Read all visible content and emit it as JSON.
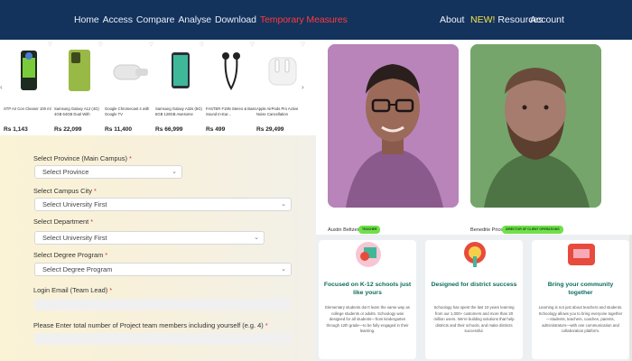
{
  "topnav": {
    "left_items": [
      "Home",
      "Access",
      "Compare",
      "Analyse",
      "Download"
    ],
    "highlight_item": "Temporary Measures",
    "about": "About",
    "new_badge": "NEW!",
    "resources": "Resources",
    "account": "Account",
    "colors": {
      "bar": "#13325c",
      "highlight": "#ff3b3b",
      "new": "#f6e34c"
    }
  },
  "products": [
    {
      "name": "STP Air Con Cleaner 100 ml",
      "price": "Rs 1,143",
      "icon": "spray-can-icon"
    },
    {
      "name": "Samsung Galaxy A12 (4G) 4GB 64GB Dual With",
      "price": "Rs 22,099",
      "icon": "phone-icon"
    },
    {
      "name": "Google Chromecast 4 with Google TV",
      "price": "Rs 11,400",
      "icon": "chromecast-icon"
    },
    {
      "name": "Samsung Galaxy A32s (5G) 6GB 128GB Awesome",
      "price": "Rs 66,999",
      "icon": "phone-icon"
    },
    {
      "name": "FASTER F19N Stereo & Bass Sound In-Ear...",
      "price": "Rs 499",
      "icon": "earphones-icon"
    },
    {
      "name": "Apple AirPods Pro Active Noise Cancellation",
      "price": "Rs 29,499",
      "icon": "airpods-icon"
    }
  ],
  "form": {
    "province_label": "Select Province (Main Campus)",
    "province_value": "Select Province",
    "city_label": "Select Campus City",
    "city_value": "Select University First",
    "department_label": "Select Department",
    "department_value": "Select University First",
    "degree_label": "Select Degree Program",
    "degree_value": "Select Degree Program",
    "email_label": "Login Email (Team Lead)",
    "members_label": "Please Enter total number of Project team members including yourself (e.g. 4)",
    "required_mark": "*"
  },
  "people": [
    {
      "name": "Austin Beltzer",
      "badge": "TEACHER"
    },
    {
      "name": "Benedite Price",
      "badge": "DIRECTOR OF CLIENT OPERATIONS"
    }
  ],
  "cards": [
    {
      "title": "Focused on K-12 schools just like yours",
      "body": "Elementary students don't learn the same way as college students or adults. Schoology was designed for all students—from kindergarten through 12th grade—to be fully engaged in their learning.",
      "icon": "teacher-icon"
    },
    {
      "title": "Designed for district success",
      "body": "Schoology has spent the last 10 years learning from our 1,000+ customers and more than 20 million users. We're building solutions that help districts and their schools, and make districts successful.",
      "icon": "plant-icon"
    },
    {
      "title": "Bring your community together",
      "body": "Learning is not just about teachers and students. Schoology allows you to bring everyone together—students, teachers, coaches, parents, administrators—with one communication and collaboration platform.",
      "icon": "community-icon"
    }
  ]
}
